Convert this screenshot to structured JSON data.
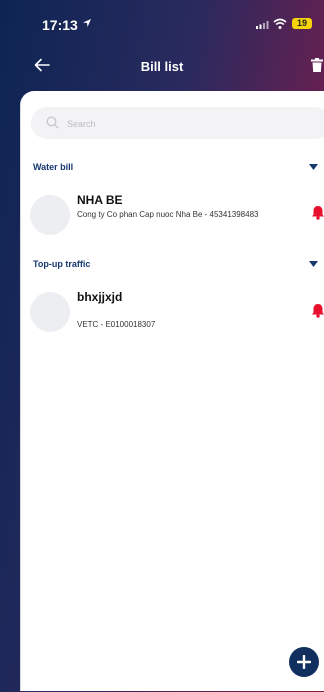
{
  "status_bar": {
    "time": "17:13",
    "battery": "19",
    "icons": [
      "location-arrow-icon",
      "signal-icon",
      "wifi-icon",
      "battery-icon"
    ]
  },
  "header": {
    "title": "Bill list",
    "back_icon": "arrow-left-icon",
    "action_icon": "trash-icon"
  },
  "search": {
    "placeholder": "Search",
    "value": ""
  },
  "sections": [
    {
      "title": "Water bill",
      "items": [
        {
          "name": "NHA BE",
          "description": "Cong ty Co phan Cap nuoc Nha Be - 45341398483",
          "alert_icon": "bell-icon"
        }
      ]
    },
    {
      "title": "Top-up traffic",
      "items": [
        {
          "name": "bhxjjxjd",
          "description": "VETC - E0100018307",
          "alert_icon": "bell-icon"
        }
      ]
    }
  ],
  "fab": {
    "icon": "plus-icon"
  },
  "colors": {
    "header_gradient_start": "#0d2553",
    "header_gradient_end": "#8a1c3c",
    "section_title": "#17386f",
    "bell": "#e8112d",
    "fab": "#11305f",
    "battery": "#f5d20a"
  }
}
